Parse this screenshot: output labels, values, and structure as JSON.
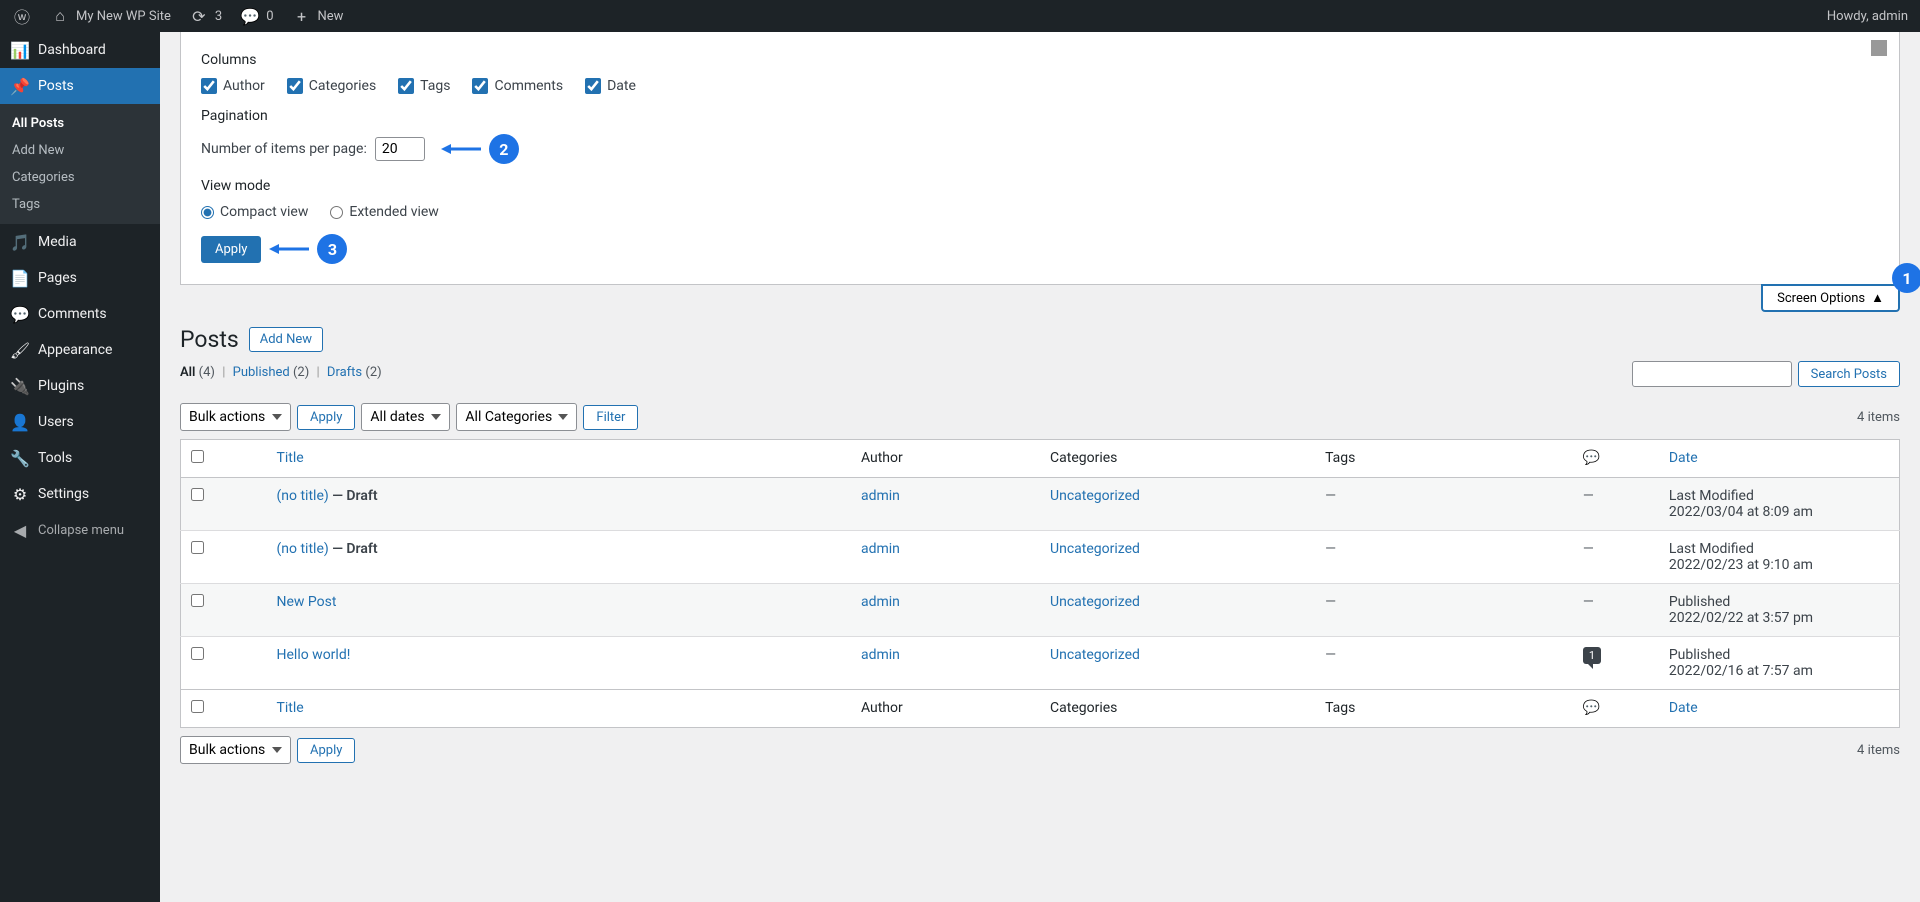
{
  "adminBar": {
    "siteName": "My New WP Site",
    "updates": "3",
    "comments": "0",
    "new": "New",
    "howdy": "Howdy, admin"
  },
  "sidebar": {
    "dashboard": "Dashboard",
    "posts": "Posts",
    "postsSub": {
      "all": "All Posts",
      "addNew": "Add New",
      "categories": "Categories",
      "tags": "Tags"
    },
    "media": "Media",
    "pages": "Pages",
    "comments": "Comments",
    "appearance": "Appearance",
    "plugins": "Plugins",
    "users": "Users",
    "tools": "Tools",
    "settings": "Settings",
    "collapse": "Collapse menu"
  },
  "screenOptions": {
    "columnsLegend": "Columns",
    "author": "Author",
    "categories": "Categories",
    "tags": "Tags",
    "commentsLbl": "Comments",
    "date": "Date",
    "paginationLegend": "Pagination",
    "itemsPerPageLabel": "Number of items per page:",
    "itemsPerPage": "20",
    "viewModeLegend": "View mode",
    "compact": "Compact view",
    "extended": "Extended view",
    "apply": "Apply",
    "tabLabel": "Screen Options"
  },
  "annotations": {
    "one": "1",
    "two": "2",
    "three": "3"
  },
  "page": {
    "title": "Posts",
    "addNew": "Add New"
  },
  "filters": {
    "all": "All",
    "allCount": "(4)",
    "published": "Published",
    "publishedCount": "(2)",
    "drafts": "Drafts",
    "draftsCount": "(2)"
  },
  "search": {
    "placeholder": "",
    "button": "Search Posts"
  },
  "tablenav": {
    "bulkActions": "Bulk actions",
    "apply": "Apply",
    "allDates": "All dates",
    "allCategories": "All Categories",
    "filter": "Filter",
    "itemCount": "4 items"
  },
  "table": {
    "headers": {
      "title": "Title",
      "author": "Author",
      "categories": "Categories",
      "tags": "Tags",
      "date": "Date"
    },
    "dash": "—",
    "rows": [
      {
        "title": "(no title)",
        "state": " — Draft",
        "author": "admin",
        "categories": "Uncategorized",
        "tags": "—",
        "comments": "—",
        "dateLabel": "Last Modified",
        "dateValue": "2022/03/04 at 8:09 am"
      },
      {
        "title": "(no title)",
        "state": " — Draft",
        "author": "admin",
        "categories": "Uncategorized",
        "tags": "—",
        "comments": "—",
        "dateLabel": "Last Modified",
        "dateValue": "2022/02/23 at 9:10 am"
      },
      {
        "title": "New Post",
        "state": "",
        "author": "admin",
        "categories": "Uncategorized",
        "tags": "—",
        "comments": "—",
        "dateLabel": "Published",
        "dateValue": "2022/02/22 at 3:57 pm"
      },
      {
        "title": "Hello world!",
        "state": "",
        "author": "admin",
        "categories": "Uncategorized",
        "tags": "—",
        "comments": "1",
        "dateLabel": "Published",
        "dateValue": "2022/02/16 at 7:57 am"
      }
    ]
  }
}
